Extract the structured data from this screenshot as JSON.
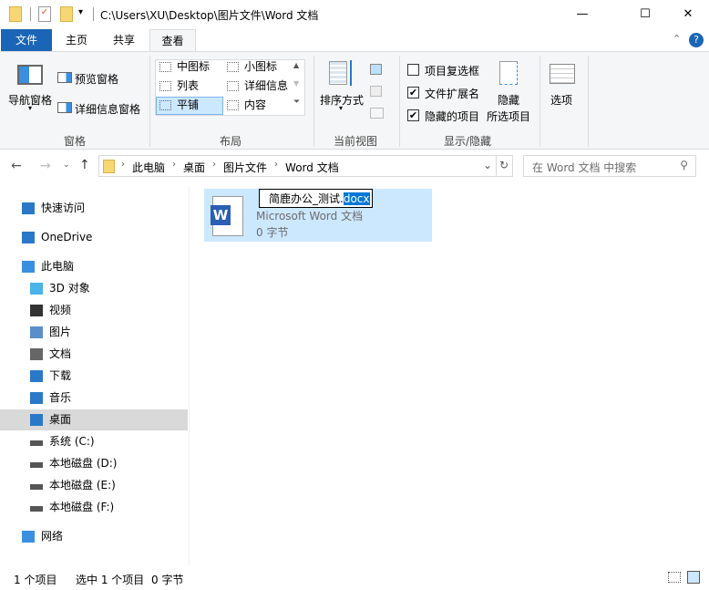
{
  "title": "C:\\Users\\XU\\Desktop\\图片文件\\Word 文档",
  "window_controls": {
    "minimize": "—",
    "maximize": "☐",
    "close": "✕"
  },
  "tabs": [
    "文件",
    "主页",
    "共享",
    "查看"
  ],
  "ribbon": {
    "pane": {
      "nav": "导航窗格",
      "preview": "预览窗格",
      "details": "详细信息窗格",
      "label": "窗格"
    },
    "layout": {
      "items": [
        "中图标",
        "小图标",
        "列表",
        "详细信息",
        "平铺",
        "内容"
      ],
      "selected": "平铺",
      "label": "布局"
    },
    "current_view": {
      "sort": "排序方式",
      "label": "当前视图"
    },
    "show_hide": {
      "checkboxes": [
        {
          "label": "项目复选框",
          "checked": false
        },
        {
          "label": "文件扩展名",
          "checked": true
        },
        {
          "label": "隐藏的项目",
          "checked": true
        }
      ],
      "hide_selected_1": "隐藏",
      "hide_selected_2": "所选项目",
      "label": "显示/隐藏"
    },
    "options": "选项"
  },
  "address": {
    "crumbs": [
      "此电脑",
      "桌面",
      "图片文件",
      "Word 文档"
    ]
  },
  "search": {
    "placeholder": "在 Word 文档 中搜索"
  },
  "nav": [
    {
      "label": "快速访问"
    },
    {
      "label": "OneDrive"
    },
    {
      "label": "此电脑"
    },
    {
      "label": "3D 对象"
    },
    {
      "label": "视频"
    },
    {
      "label": "图片"
    },
    {
      "label": "文档"
    },
    {
      "label": "下载"
    },
    {
      "label": "音乐"
    },
    {
      "label": "桌面"
    },
    {
      "label": "系统 (C:)"
    },
    {
      "label": "本地磁盘 (D:)"
    },
    {
      "label": "本地磁盘 (E:)"
    },
    {
      "label": "本地磁盘 (F:)"
    },
    {
      "label": "网络"
    }
  ],
  "file": {
    "name_base": "简鹿办公_测试.",
    "name_ext": "docx",
    "type": "Microsoft Word 文档",
    "size": "0 字节"
  },
  "status": {
    "count": "1 个项目",
    "selected": "选中 1 个项目",
    "size": "0 字节"
  }
}
